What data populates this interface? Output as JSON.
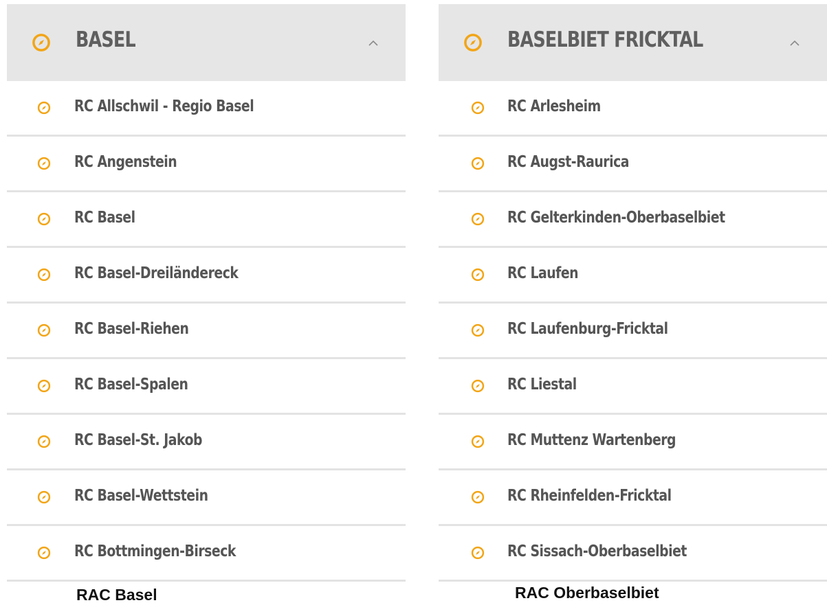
{
  "colors": {
    "accent": "#f2a516",
    "header_bg": "#e6e6e6",
    "text": "#555555",
    "divider": "#e3e3e3"
  },
  "panels": [
    {
      "title": "BASEL",
      "header_icon": "compass-icon",
      "toggle_icon": "chevron-up-icon",
      "items": [
        {
          "label": "RC Allschwil - Regio Basel",
          "icon": "compass-icon"
        },
        {
          "label": "RC Angenstein",
          "icon": "compass-icon"
        },
        {
          "label": "RC Basel",
          "icon": "compass-icon"
        },
        {
          "label": "RC Basel-Dreiländereck",
          "icon": "compass-icon"
        },
        {
          "label": "RC Basel-Riehen",
          "icon": "compass-icon"
        },
        {
          "label": "RC Basel-Spalen",
          "icon": "compass-icon"
        },
        {
          "label": "RC Basel-St. Jakob",
          "icon": "compass-icon"
        },
        {
          "label": "RC Basel-Wettstein",
          "icon": "compass-icon"
        },
        {
          "label": "RC Bottmingen-Birseck",
          "icon": "compass-icon"
        }
      ],
      "caption": "RAC Basel"
    },
    {
      "title": "BASELBIET FRICKTAL",
      "header_icon": "compass-icon",
      "toggle_icon": "chevron-up-icon",
      "items": [
        {
          "label": "RC Arlesheim",
          "icon": "compass-icon"
        },
        {
          "label": "RC Augst-Raurica",
          "icon": "compass-icon"
        },
        {
          "label": "RC Gelterkinden-Oberbaselbiet",
          "icon": "compass-icon"
        },
        {
          "label": "RC Laufen",
          "icon": "compass-icon"
        },
        {
          "label": "RC Laufenburg-Fricktal",
          "icon": "compass-icon"
        },
        {
          "label": "RC Liestal",
          "icon": "compass-icon"
        },
        {
          "label": "RC Muttenz Wartenberg",
          "icon": "compass-icon"
        },
        {
          "label": "RC Rheinfelden-Fricktal",
          "icon": "compass-icon"
        },
        {
          "label": "RC Sissach-Oberbaselbiet",
          "icon": "compass-icon"
        }
      ],
      "caption": "RAC Oberbaselbiet"
    }
  ]
}
